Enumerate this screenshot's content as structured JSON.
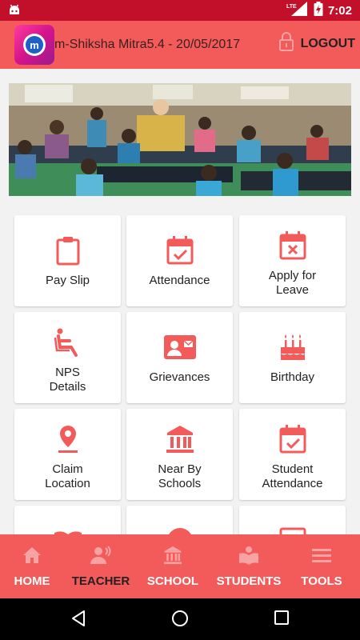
{
  "status_bar": {
    "network": "LTE",
    "time": "7:02"
  },
  "app_bar": {
    "logo_letter": "m",
    "title": "m-Shiksha Mitra5.4 - 20/05/2017",
    "logout_label": "LOGOUT"
  },
  "banner": {
    "description_icon": "classroom-photo"
  },
  "tiles": [
    {
      "label": "Pay Slip",
      "icon": "clipboard-icon"
    },
    {
      "label": "Attendance",
      "icon": "calendar-check-icon"
    },
    {
      "label": "Apply for\nLeave",
      "icon": "calendar-x-icon"
    },
    {
      "label": "NPS\nDetails",
      "icon": "seat-icon"
    },
    {
      "label": "Grievances",
      "icon": "contact-card-icon"
    },
    {
      "label": "Birthday",
      "icon": "cake-icon"
    },
    {
      "label": "Claim\nLocation",
      "icon": "location-pin-icon"
    },
    {
      "label": "Near By\nSchools",
      "icon": "bank-icon"
    },
    {
      "label": "Student\nAttendance",
      "icon": "calendar-check-icon"
    }
  ],
  "bottom_nav": [
    {
      "label": "HOME",
      "icon": "home-icon",
      "active": false
    },
    {
      "label": "TEACHER",
      "icon": "teacher-icon",
      "active": true
    },
    {
      "label": "SCHOOL",
      "icon": "bank-icon",
      "active": false
    },
    {
      "label": "STUDENTS",
      "icon": "reader-icon",
      "active": false
    },
    {
      "label": "TOOLS",
      "icon": "menu-icon",
      "active": false
    }
  ],
  "colors": {
    "status_bar": "#c2102a",
    "accent": "#f35b5b",
    "nav_icon": "#f7a3a3"
  }
}
